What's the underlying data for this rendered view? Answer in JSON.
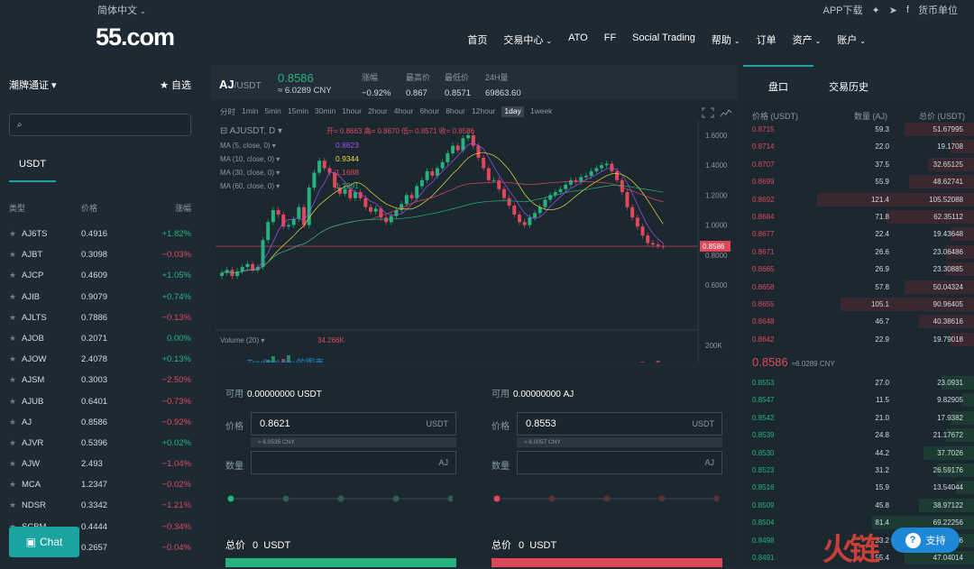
{
  "header": {
    "language": "简体中文",
    "logo": "55.com",
    "app_download": "APP下载",
    "currency_unit": "货币单位",
    "nav": [
      {
        "label": "首页",
        "chevron": false
      },
      {
        "label": "交易中心",
        "chevron": true
      },
      {
        "label": "ATO",
        "chevron": false
      },
      {
        "label": "FF",
        "chevron": false
      },
      {
        "label": "Social Trading",
        "chevron": false
      },
      {
        "label": "帮助",
        "chevron": true
      },
      {
        "label": "订单",
        "chevron": false
      },
      {
        "label": "资产",
        "chevron": true
      },
      {
        "label": "账户",
        "chevron": true
      }
    ]
  },
  "sidebar": {
    "market_title": "潮牌通证",
    "favorites": "自选",
    "quote_tab": "USDT",
    "col_type": "类型",
    "col_price": "价格",
    "col_change": "涨幅",
    "pairs": [
      {
        "sym": "AJ6TS",
        "price": "0.4916",
        "chg": "+1.82%",
        "dir": "up"
      },
      {
        "sym": "AJBT",
        "price": "0.3098",
        "chg": "−0.03%",
        "dir": "dn"
      },
      {
        "sym": "AJCP",
        "price": "0.4609",
        "chg": "+1.05%",
        "dir": "up"
      },
      {
        "sym": "AJIB",
        "price": "0.9079",
        "chg": "+0.74%",
        "dir": "up"
      },
      {
        "sym": "AJLTS",
        "price": "0.7886",
        "chg": "−0.13%",
        "dir": "dn"
      },
      {
        "sym": "AJOB",
        "price": "0.2071",
        "chg": "0.00%",
        "dir": "up"
      },
      {
        "sym": "AJOW",
        "price": "2.4078",
        "chg": "+0.13%",
        "dir": "up"
      },
      {
        "sym": "AJSM",
        "price": "0.3003",
        "chg": "−2.50%",
        "dir": "dn"
      },
      {
        "sym": "AJUB",
        "price": "0.6401",
        "chg": "−0.73%",
        "dir": "dn"
      },
      {
        "sym": "AJ",
        "price": "0.8586",
        "chg": "−0.92%",
        "dir": "dn"
      },
      {
        "sym": "AJVR",
        "price": "0.5396",
        "chg": "+0.02%",
        "dir": "up"
      },
      {
        "sym": "AJW",
        "price": "2.493",
        "chg": "−1.04%",
        "dir": "dn"
      },
      {
        "sym": "MCA",
        "price": "1.2347",
        "chg": "−0.02%",
        "dir": "dn"
      },
      {
        "sym": "NDSR",
        "price": "0.3342",
        "chg": "−1.21%",
        "dir": "dn"
      },
      {
        "sym": "SCBM",
        "price": "0.4444",
        "chg": "−0.34%",
        "dir": "dn"
      },
      {
        "sym": "",
        "price": "0.2657",
        "chg": "−0.04%",
        "dir": "dn"
      }
    ],
    "chat_label": "Chat"
  },
  "ticker": {
    "base": "AJ",
    "quote": "/USDT",
    "price": "0.8586",
    "cny": "≈ 6.0289 CNY",
    "stats": [
      {
        "label": "涨幅",
        "value": "−0.92%",
        "dir": "dn"
      },
      {
        "label": "最高价",
        "value": "0.867",
        "dir": ""
      },
      {
        "label": "最低价",
        "value": "0.8571",
        "dir": ""
      },
      {
        "label": "24H量",
        "value": "69863.60",
        "dir": ""
      }
    ]
  },
  "chart": {
    "intervals": [
      "分时",
      "1min",
      "5min",
      "15min",
      "30min",
      "1hour",
      "2hour",
      "4hour",
      "6hour",
      "8hour",
      "12hour",
      "1day",
      "1week"
    ],
    "active_interval": "1day",
    "legend_title": "AJUSDT, D",
    "ohlc": "开= 0.8663  高= 0.8670  低= 0.8571  收= 0.8586",
    "ma": [
      {
        "label": "MA (5, close, 0)",
        "value": "0.8623",
        "color": "#a24ff0"
      },
      {
        "label": "MA (10, close, 0)",
        "value": "0.9344",
        "color": "#f0d838"
      },
      {
        "label": "MA (30, close, 0)",
        "value": "1.1688",
        "color": "#e0485a"
      },
      {
        "label": "MA (60, close, 0)",
        "value": "1.2291",
        "color": "#26b27e"
      }
    ],
    "volume_label": "Volume (20)",
    "volume_value": "34.266K",
    "watermark": "TradingView的图表",
    "y_ticks": [
      "1.6000",
      "1.4000",
      "1.2000",
      "1.0000",
      "0.8000",
      "0.6000"
    ],
    "vol_ticks": [
      "200K",
      "0"
    ],
    "x_ticks": [
      "8月",
      "16",
      "9月",
      "16",
      "10月",
      "16",
      "11月",
      "16",
      "12月"
    ],
    "last_price_tag": "0.8586"
  },
  "trade": {
    "buy": {
      "avail_label": "可用",
      "avail_value": "0.00000000",
      "avail_unit": "USDT",
      "price_label": "价格",
      "price_value": "0.8621",
      "price_unit": "USDT",
      "price_hint": "≈ 6.0535 CNY",
      "qty_label": "数量",
      "qty_unit": "AJ",
      "total_label": "总价",
      "total_value": "0",
      "total_unit": "USDT"
    },
    "sell": {
      "avail_label": "可用",
      "avail_value": "0.00000000",
      "avail_unit": "AJ",
      "price_label": "价格",
      "price_value": "0.8553",
      "price_unit": "USDT",
      "price_hint": "≈ 6.0057 CNY",
      "qty_label": "数量",
      "qty_unit": "AJ",
      "total_label": "总价",
      "total_value": "0",
      "total_unit": "USDT"
    }
  },
  "orderbook": {
    "tab_book": "盘口",
    "tab_history": "交易历史",
    "col_price": "价格 (USDT)",
    "col_amount": "数量 (AJ)",
    "col_total": "总价 (USDT)",
    "asks": [
      {
        "p": "0.8715",
        "a": "59.3",
        "t": "51.67995",
        "depth": 0.3
      },
      {
        "p": "0.8714",
        "a": "22.0",
        "t": "19.1708",
        "depth": 0.1
      },
      {
        "p": "0.8707",
        "a": "37.5",
        "t": "32.65125",
        "depth": 0.2
      },
      {
        "p": "0.8699",
        "a": "55.9",
        "t": "48.62741",
        "depth": 0.28
      },
      {
        "p": "0.8692",
        "a": "121.4",
        "t": "105.52088",
        "depth": 0.68
      },
      {
        "p": "0.8684",
        "a": "71.8",
        "t": "62.35112",
        "depth": 0.38
      },
      {
        "p": "0.8677",
        "a": "22.4",
        "t": "19.43648",
        "depth": 0.1
      },
      {
        "p": "0.8671",
        "a": "26.6",
        "t": "23.06486",
        "depth": 0.12
      },
      {
        "p": "0.8665",
        "a": "26.9",
        "t": "23.30885",
        "depth": 0.12
      },
      {
        "p": "0.8658",
        "a": "57.8",
        "t": "50.04324",
        "depth": 0.3
      },
      {
        "p": "0.8655",
        "a": "105.1",
        "t": "90.96405",
        "depth": 0.58
      },
      {
        "p": "0.8648",
        "a": "46.7",
        "t": "40.38616",
        "depth": 0.24
      },
      {
        "p": "0.8642",
        "a": "22.9",
        "t": "19.79018",
        "depth": 0.1
      }
    ],
    "last_price": "0.8586",
    "last_cny": "≈6.0289 CNY",
    "bids": [
      {
        "p": "0.8553",
        "a": "27.0",
        "t": "23.0931",
        "depth": 0.14
      },
      {
        "p": "0.8547",
        "a": "11.5",
        "t": "9.82905",
        "depth": 0.05
      },
      {
        "p": "0.8542",
        "a": "21.0",
        "t": "17.9382",
        "depth": 0.1
      },
      {
        "p": "0.8539",
        "a": "24.8",
        "t": "21.17672",
        "depth": 0.12
      },
      {
        "p": "0.8530",
        "a": "44.2",
        "t": "37.7026",
        "depth": 0.22
      },
      {
        "p": "0.8523",
        "a": "31.2",
        "t": "26.59176",
        "depth": 0.16
      },
      {
        "p": "0.8516",
        "a": "15.9",
        "t": "13.54044",
        "depth": 0.08
      },
      {
        "p": "0.8509",
        "a": "45.8",
        "t": "38.97122",
        "depth": 0.24
      },
      {
        "p": "0.8504",
        "a": "81.4",
        "t": "69.22256",
        "depth": 0.44
      },
      {
        "p": "0.8498",
        "a": "33.2",
        "t": "28.21336",
        "depth": 0.18
      },
      {
        "p": "0.8491",
        "a": "55.4",
        "t": "47.04014",
        "depth": 0.3
      }
    ]
  },
  "support_label": "支持",
  "watermark_logo": "火链"
}
